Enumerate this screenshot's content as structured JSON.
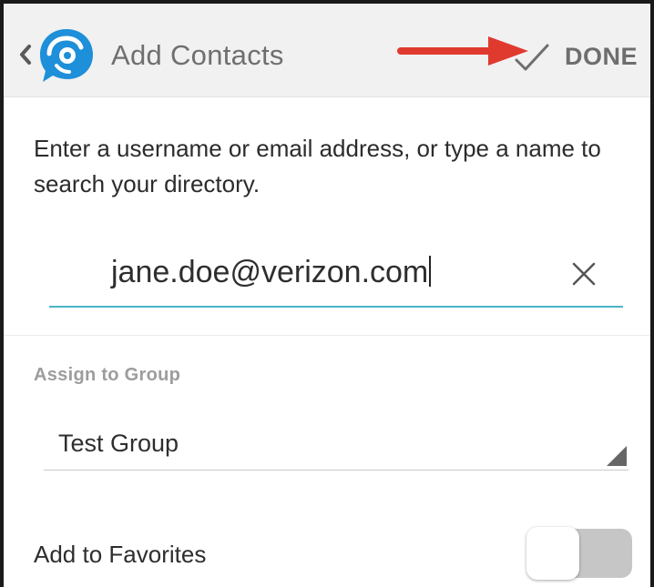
{
  "header": {
    "title": "Add Contacts",
    "back_icon": "chevron-left-icon",
    "logo_icon": "chat-bubble-logo-icon",
    "done_label": "DONE",
    "done_icon": "checkmark-icon"
  },
  "instructions": "Enter a username or email address, or type a name to search your directory.",
  "search": {
    "value": "jane.doe@verizon.com",
    "clear_icon": "close-icon"
  },
  "group": {
    "label": "Assign to Group",
    "selected": "Test Group"
  },
  "favorites": {
    "label": "Add to Favorites",
    "enabled": false
  },
  "colors": {
    "accent": "#4ab4c9",
    "logo": "#1e8fd9",
    "annotation_arrow": "#e03a2f",
    "header_bg": "#f1f1f1"
  }
}
